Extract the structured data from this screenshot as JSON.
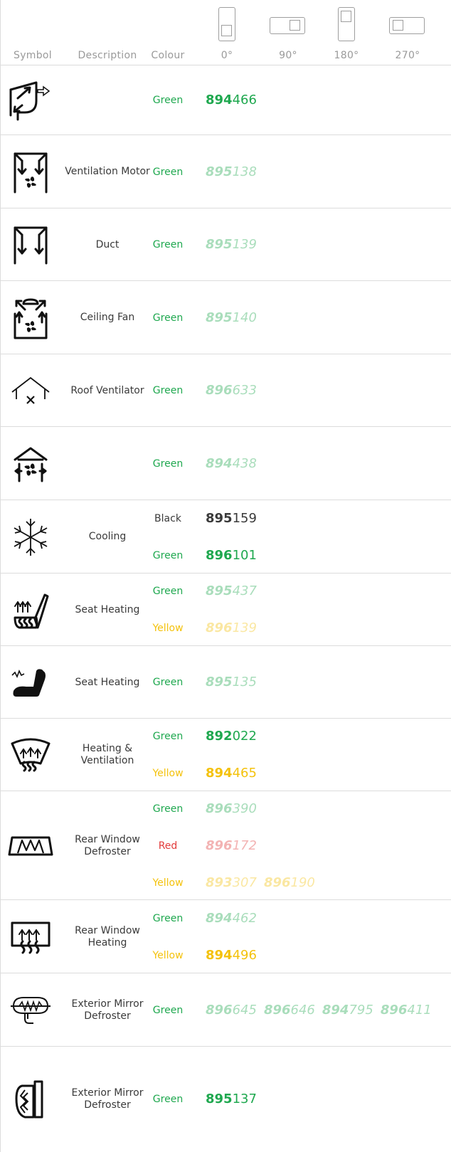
{
  "header": {
    "symbol": "Symbol",
    "description": "Description",
    "colour": "Colour",
    "orientations": [
      "0°",
      "90°",
      "180°",
      "270°"
    ]
  },
  "colors": {
    "Green": "#1fa84f",
    "Black": "#3a3a3a",
    "Yellow": "#f4c20d",
    "Red": "#e23b3b",
    "border": "#dcdcdc"
  },
  "rows": [
    {
      "icon": "ventilation-arrow-icon",
      "description": "",
      "lines": [
        {
          "colour": "Green",
          "codes": [
            {
              "prefix": "894",
              "suffix": "466",
              "available": true
            }
          ]
        }
      ]
    },
    {
      "icon": "ventilation-motor-icon",
      "description": "Ventilation Motor",
      "lines": [
        {
          "colour": "Green",
          "codes": [
            {
              "prefix": "895",
              "suffix": "138",
              "available": false
            }
          ]
        }
      ]
    },
    {
      "icon": "duct-icon",
      "description": "Duct",
      "lines": [
        {
          "colour": "Green",
          "codes": [
            {
              "prefix": "895",
              "suffix": "139",
              "available": false
            }
          ]
        }
      ]
    },
    {
      "icon": "ceiling-fan-icon",
      "description": "Ceiling Fan",
      "lines": [
        {
          "colour": "Green",
          "codes": [
            {
              "prefix": "895",
              "suffix": "140",
              "available": false
            }
          ]
        }
      ]
    },
    {
      "icon": "roof-ventilator-icon",
      "description": "Roof Ventilator",
      "lines": [
        {
          "colour": "Green",
          "codes": [
            {
              "prefix": "896",
              "suffix": "633",
              "available": false
            }
          ]
        }
      ]
    },
    {
      "icon": "roof-fan-icon",
      "description": "",
      "lines": [
        {
          "colour": "Green",
          "codes": [
            {
              "prefix": "894",
              "suffix": "438",
              "available": false
            }
          ]
        }
      ]
    },
    {
      "icon": "snowflake-icon",
      "description": "Cooling",
      "lines": [
        {
          "colour": "Black",
          "codes": [
            {
              "prefix": "895",
              "suffix": "159",
              "available": true
            }
          ]
        },
        {
          "colour": "Green",
          "codes": [
            {
              "prefix": "896",
              "suffix": "101",
              "available": true
            }
          ]
        }
      ]
    },
    {
      "icon": "seat-heating-icon",
      "description": "Seat Heating",
      "lines": [
        {
          "colour": "Green",
          "codes": [
            {
              "prefix": "895",
              "suffix": "437",
              "available": false
            }
          ]
        },
        {
          "colour": "Yellow",
          "codes": [
            {
              "prefix": "896",
              "suffix": "139",
              "available": false
            }
          ]
        }
      ]
    },
    {
      "icon": "seat-heating-alt-icon",
      "description": "Seat Heating",
      "lines": [
        {
          "colour": "Green",
          "codes": [
            {
              "prefix": "895",
              "suffix": "135",
              "available": false
            }
          ]
        }
      ]
    },
    {
      "icon": "windscreen-heating-icon",
      "description": "Heating & Ventilation",
      "lines": [
        {
          "colour": "Green",
          "codes": [
            {
              "prefix": "892",
              "suffix": "022",
              "available": true
            }
          ]
        },
        {
          "colour": "Yellow",
          "codes": [
            {
              "prefix": "894",
              "suffix": "465",
              "available": true
            }
          ]
        }
      ]
    },
    {
      "icon": "rear-window-defroster-icon",
      "description": "Rear Window Defroster",
      "lines": [
        {
          "colour": "Green",
          "codes": [
            {
              "prefix": "896",
              "suffix": "390",
              "available": false
            }
          ]
        },
        {
          "colour": "Red",
          "codes": [
            {
              "prefix": "896",
              "suffix": "172",
              "available": false
            }
          ]
        },
        {
          "colour": "Yellow",
          "codes": [
            {
              "prefix": "893",
              "suffix": "307",
              "available": false
            },
            {
              "prefix": "896",
              "suffix": "190",
              "available": false
            }
          ]
        }
      ]
    },
    {
      "icon": "rear-window-heating-icon",
      "description": "Rear Window Heating",
      "lines": [
        {
          "colour": "Green",
          "codes": [
            {
              "prefix": "894",
              "suffix": "462",
              "available": false
            }
          ]
        },
        {
          "colour": "Yellow",
          "codes": [
            {
              "prefix": "894",
              "suffix": "496",
              "available": true
            }
          ]
        }
      ]
    },
    {
      "icon": "exterior-mirror-defroster-icon",
      "description": "Exterior Mirror Defroster",
      "lines": [
        {
          "colour": "Green",
          "codes": [
            {
              "prefix": "896",
              "suffix": "645",
              "available": false
            },
            {
              "prefix": "896",
              "suffix": "646",
              "available": false
            },
            {
              "prefix": "894",
              "suffix": "795",
              "available": false
            },
            {
              "prefix": "896",
              "suffix": "411",
              "available": false
            }
          ]
        }
      ]
    },
    {
      "icon": "exterior-mirror-heating-icon",
      "description": "Exterior Mirror Defroster",
      "lines": [
        {
          "colour": "Green",
          "codes": [
            {
              "prefix": "895",
              "suffix": "137",
              "available": true
            }
          ]
        }
      ]
    }
  ]
}
